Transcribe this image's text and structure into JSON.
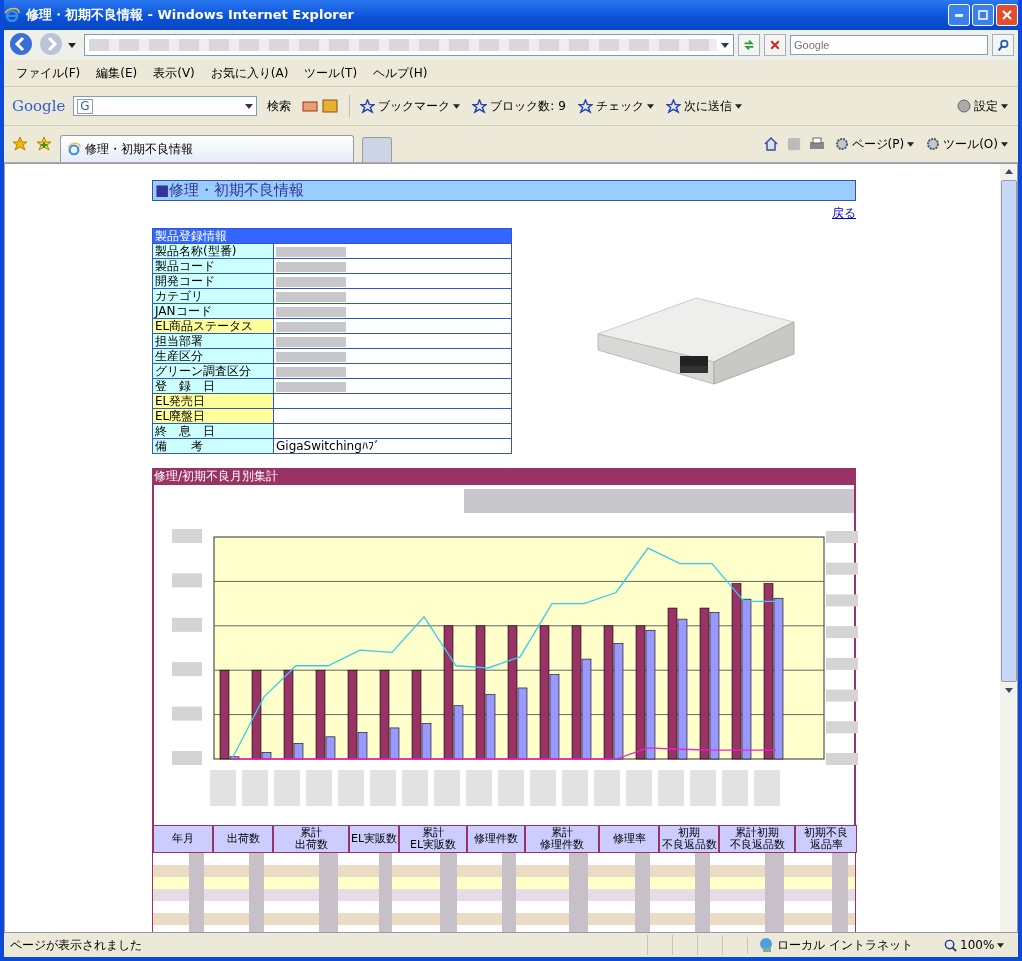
{
  "window": {
    "title": "修理・初期不良情報 - Windows Internet Explorer"
  },
  "address_bar": {
    "search_placeholder": "Google"
  },
  "menu": [
    "ファイル(F)",
    "編集(E)",
    "表示(V)",
    "お気に入り(A)",
    "ツール(T)",
    "ヘルプ(H)"
  ],
  "google_toolbar": {
    "logo": "Google",
    "engine": "G",
    "search_button": "検索",
    "items": [
      {
        "label": "ブックマーク",
        "dropdown": true
      },
      {
        "label": "ブロック数: 9",
        "dropdown": false
      },
      {
        "label": "チェック",
        "dropdown": true
      },
      {
        "label": "次に送信",
        "dropdown": true
      }
    ],
    "settings": "設定"
  },
  "tabs": [
    {
      "label": "修理・初期不良情報",
      "selected": true
    }
  ],
  "command_bar": [
    "ページ(P)",
    "ツール(O)"
  ],
  "page": {
    "heading": "■修理・初期不良情報",
    "back_link": "戻る",
    "product_info": {
      "title": "製品登録情報",
      "rows": [
        {
          "label": "製品名称(型番)",
          "highlighted": false,
          "redacted": true
        },
        {
          "label": "製品コード",
          "highlighted": false,
          "redacted": true
        },
        {
          "label": "開発コード",
          "highlighted": false,
          "redacted": true
        },
        {
          "label": "カテゴリ",
          "highlighted": false,
          "redacted": true
        },
        {
          "label": "JANコード",
          "highlighted": false,
          "redacted": true
        },
        {
          "label": "EL商品ステータス",
          "highlighted": true,
          "redacted": true
        },
        {
          "label": "担当部署",
          "highlighted": false,
          "redacted": true
        },
        {
          "label": "生産区分",
          "highlighted": false,
          "redacted": true
        },
        {
          "label": "グリーン調査区分",
          "highlighted": false,
          "redacted": true
        },
        {
          "label": "登　録　日",
          "highlighted": false,
          "redacted": true
        },
        {
          "label": "EL発売日",
          "highlighted": true,
          "redacted": false
        },
        {
          "label": "EL廃盤日",
          "highlighted": true,
          "redacted": false
        },
        {
          "label": "終　息　日",
          "highlighted": false,
          "redacted": false
        },
        {
          "label": "備　　考",
          "highlighted": false,
          "redacted": false,
          "value": "GigaSwitchingﾊﾌﾞ"
        }
      ]
    },
    "monthly": {
      "title": "修理/初期不良月別集計",
      "columns": [
        {
          "lines": [
            "年月"
          ]
        },
        {
          "lines": [
            "出荷数"
          ]
        },
        {
          "lines": [
            "累計",
            "出荷数"
          ]
        },
        {
          "lines": [
            "EL実販数"
          ]
        },
        {
          "lines": [
            "累計",
            "EL実販数"
          ]
        },
        {
          "lines": [
            "修理件数"
          ]
        },
        {
          "lines": [
            "累計",
            "修理件数"
          ]
        },
        {
          "lines": [
            "修理率"
          ]
        },
        {
          "lines": [
            "初期",
            "不良返品数"
          ]
        },
        {
          "lines": [
            "累計初期",
            "不良返品数"
          ]
        },
        {
          "lines": [
            "初期不良",
            "返品率"
          ]
        }
      ]
    }
  },
  "status_bar": {
    "text": "ページが表示されました",
    "zone": "ローカル イントラネット",
    "zoom": "100%"
  }
}
